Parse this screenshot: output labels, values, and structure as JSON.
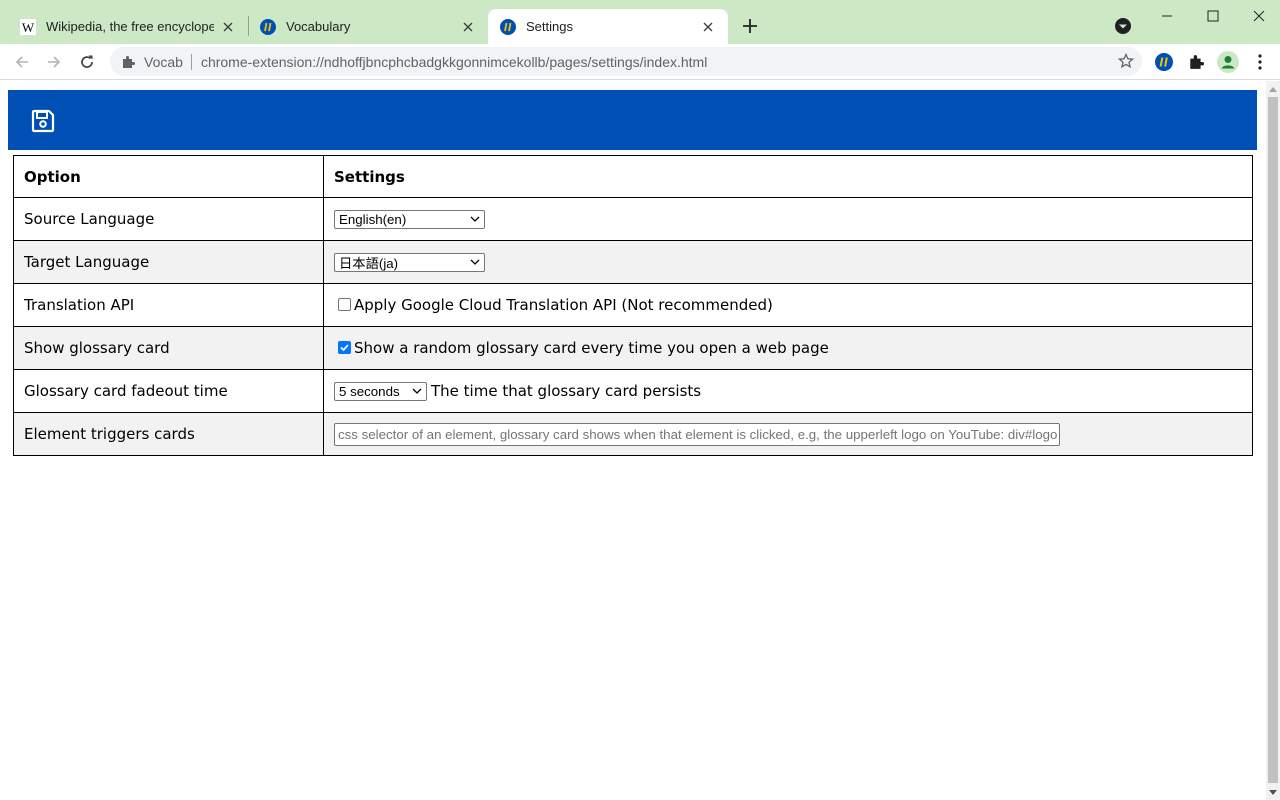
{
  "browser": {
    "tabs": [
      {
        "title": "Wikipedia, the free encyclopedia",
        "favicon": "wikipedia-w-icon",
        "active": false
      },
      {
        "title": "Vocabulary",
        "favicon": "vocab-extension-icon",
        "active": false
      },
      {
        "title": "Settings",
        "favicon": "vocab-extension-icon",
        "active": true
      }
    ],
    "omnibox": {
      "chip": "Vocab",
      "url": "chrome-extension://ndhoffjbncphcbadgkkgonnimcekollb/pages/settings/index.html"
    },
    "colors": {
      "tabstrip": "#cde8c4",
      "accent": "#004fb4"
    }
  },
  "settings_page": {
    "header": {
      "save_icon": "save-icon",
      "bar_color": "#004fb4"
    },
    "table": {
      "col_option": "Option",
      "col_settings": "Settings",
      "rows": [
        {
          "label": "Source Language",
          "control": "select",
          "value": "English(en)"
        },
        {
          "label": "Target Language",
          "control": "select",
          "value": "日本語(ja)"
        },
        {
          "label": "Translation API",
          "control": "checkbox",
          "checked": false,
          "text": "Apply Google Cloud Translation API (Not recommended)"
        },
        {
          "label": "Show glossary card",
          "control": "checkbox",
          "checked": true,
          "text": "Show a random glossary card every time you open a web page"
        },
        {
          "label": "Glossary card fadeout time",
          "control": "select",
          "value": "5 seconds",
          "note": "The time that glossary card persists"
        },
        {
          "label": "Element triggers cards",
          "control": "text",
          "placeholder": "css selector of an element, glossary card shows when that element is clicked, e.g, the upperleft logo on YouTube: div#logo"
        }
      ]
    }
  }
}
